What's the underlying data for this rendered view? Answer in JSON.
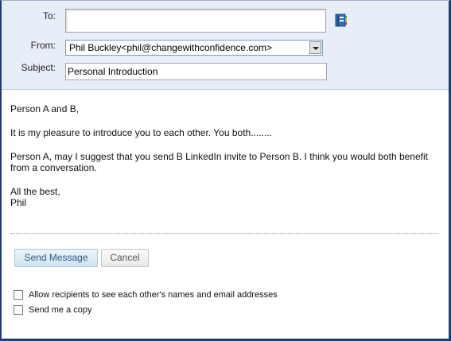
{
  "form": {
    "to_label": "To:",
    "to_value": "",
    "from_label": "From:",
    "from_value": "Phil Buckley<phil@changewithconfidence.com>",
    "subject_label": "Subject:",
    "subject_value": "Personal Introduction"
  },
  "message": {
    "line1": "Person A and B,",
    "line2": "It is my pleasure to introduce you to each other. You both........",
    "line3": "Person A, may I suggest that you send B LinkedIn invite to Person B. I think you would both benefit from a conversation.",
    "sign1": "All the best,",
    "sign2": "Phil"
  },
  "actions": {
    "send_label": "Send Message",
    "cancel_label": "Cancel"
  },
  "options": {
    "share_recipients_label": "Allow recipients to see each other's names and email addresses",
    "share_recipients_checked": false,
    "send_copy_label": "Send me a copy",
    "send_copy_checked": false
  },
  "icons": {
    "address_book": "address-book-icon"
  },
  "colors": {
    "header_bg": "#e8eef7",
    "frame": "#1f3d6e",
    "send_button_text": "#2b5d8a"
  }
}
